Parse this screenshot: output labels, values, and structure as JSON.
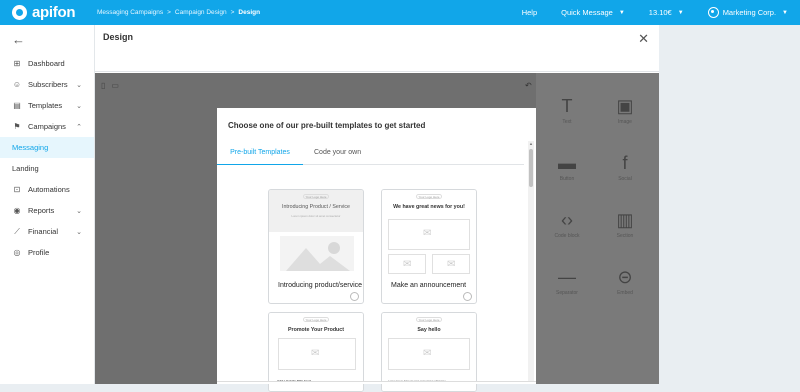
{
  "app": {
    "name": "apifon"
  },
  "breadcrumb": [
    "Messaging Campaigns",
    "Campaign Design",
    "Design"
  ],
  "topbar": {
    "help": "Help",
    "quick_message": "Quick Message",
    "balance": "13.10€",
    "account": "Marketing Corp."
  },
  "sidebar": {
    "items": [
      {
        "label": "Dashboard",
        "icon": "dashboard-icon"
      },
      {
        "label": "Subscribers",
        "icon": "smiley-icon"
      },
      {
        "label": "Templates",
        "icon": "template-icon"
      },
      {
        "label": "Campaigns",
        "icon": "campaign-icon"
      },
      {
        "label": "Messaging",
        "icon": "",
        "active": true
      },
      {
        "label": "Landing",
        "icon": ""
      },
      {
        "label": "Automations",
        "icon": "automations-icon"
      },
      {
        "label": "Reports",
        "icon": "reports-icon"
      },
      {
        "label": "Financial",
        "icon": "financial-icon"
      },
      {
        "label": "Profile",
        "icon": "profile-icon"
      }
    ]
  },
  "panel": {
    "title": "Design"
  },
  "blocks": [
    {
      "label": "Text",
      "icon": "text-block-icon"
    },
    {
      "label": "Image",
      "icon": "image-block-icon"
    },
    {
      "label": "Button",
      "icon": "button-block-icon"
    },
    {
      "label": "Social",
      "icon": "social-block-icon"
    },
    {
      "label": "Code block",
      "icon": "code-block-icon"
    },
    {
      "label": "Section",
      "icon": "section-block-icon"
    },
    {
      "label": "Separator",
      "icon": "separator-block-icon"
    },
    {
      "label": "Embed",
      "icon": "embed-block-icon"
    }
  ],
  "modal": {
    "title": "Choose one of our pre-built templates to get started",
    "tabs": [
      "Pre-built Templates",
      "Code your own"
    ],
    "cards": [
      {
        "logo": "Your Logo Here",
        "heading": "Introducing Product / Service",
        "sub": "Lorem ipsum dolor sit amet consectetur",
        "label": "Introducing product/service"
      },
      {
        "logo": "Your Logo Here",
        "heading": "We have great news for you!",
        "label": "Make an announcement"
      },
      {
        "logo": "Your Logo Here",
        "heading": "Promote Your Product",
        "footer": "Add a Catchy Title here!"
      },
      {
        "logo": "Your Logo Here",
        "heading": "Say hello",
        "footer": "Lorem ipsum dolor sit amet consectetur adipiscing"
      }
    ]
  },
  "colors": {
    "brand": "#11a6e9",
    "editor_bg": "#6f6f6f"
  }
}
